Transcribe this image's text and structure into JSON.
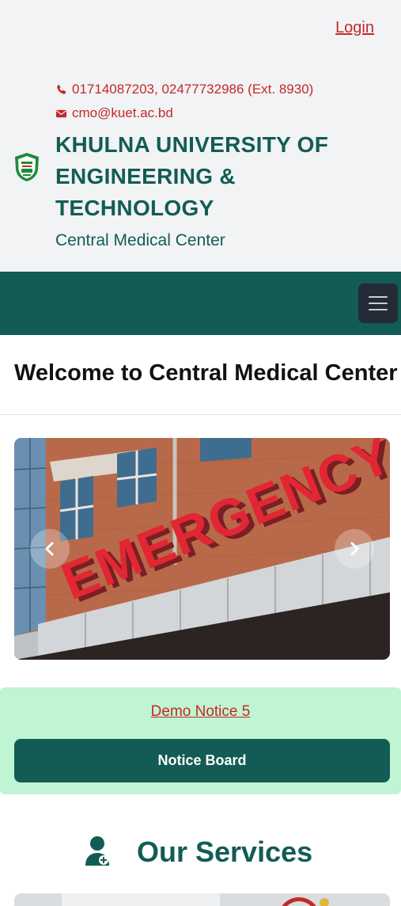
{
  "header": {
    "login_label": "Login",
    "phone": "01714087203, 02477732986 (Ext. 8930)",
    "email": "cmo@kuet.ac.bd",
    "university_name": "KHULNA UNIVERSITY OF ENGINEERING & TECHNOLOGY",
    "subtitle": "Central Medical Center",
    "logo_icon": "university-logo-icon",
    "phone_icon": "phone-icon",
    "email_icon": "envelope-icon"
  },
  "navbar": {
    "toggle_icon": "hamburger-menu-icon"
  },
  "main": {
    "welcome_heading": "Welcome to Central Medical Center",
    "carousel": {
      "prev_icon": "chevron-left-icon",
      "next_icon": "chevron-right-icon",
      "slide_sign_text": "EMERGENCY"
    },
    "notice": {
      "latest_notice": "Demo Notice 5",
      "board_button_label": "Notice Board"
    },
    "services": {
      "title": "Our Services",
      "icon": "doctor-icon"
    }
  },
  "colors": {
    "brand": "#135c55",
    "accent_link": "#c62828",
    "header_bg": "#f1f3f5",
    "notice_bg": "#bff5d2",
    "toggle_bg": "#222b36"
  }
}
